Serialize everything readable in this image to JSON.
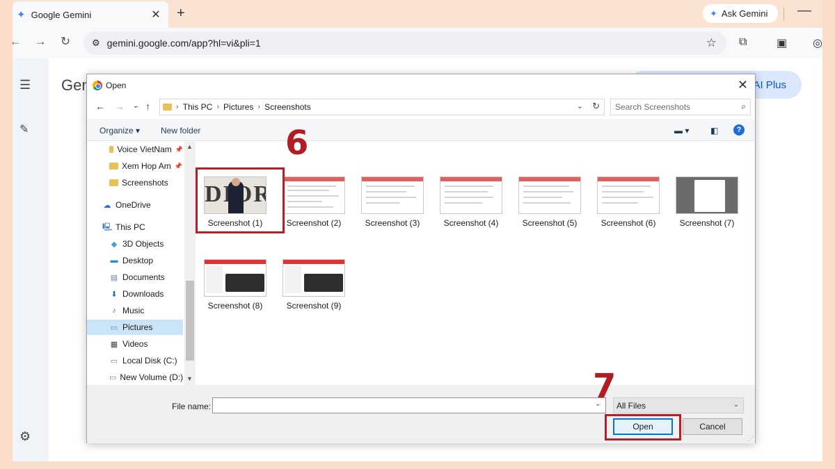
{
  "browser": {
    "tab_title": "Google Gemini",
    "tab_close": "✕",
    "new_tab": "+",
    "ask_gemini": "Ask Gemini",
    "url": "gemini.google.com/app?hl=vi&pli=1"
  },
  "gemini": {
    "title_partial": "Gen",
    "plus_label": "AI Plus"
  },
  "dialog": {
    "title": "Open",
    "breadcrumb": [
      "This PC",
      "Pictures",
      "Screenshots"
    ],
    "search_placeholder": "Search Screenshots",
    "organize": "Organize ▾",
    "new_folder": "New folder",
    "help": "?",
    "nav_items": [
      {
        "label": "Voice VietNam",
        "pinned": true
      },
      {
        "label": "Xem Hop Am",
        "pinned": true
      },
      {
        "label": "Screenshots"
      },
      {
        "label": "OneDrive"
      },
      {
        "label": "This PC"
      },
      {
        "label": "3D Objects"
      },
      {
        "label": "Desktop"
      },
      {
        "label": "Documents"
      },
      {
        "label": "Downloads"
      },
      {
        "label": "Music"
      },
      {
        "label": "Pictures",
        "selected": true
      },
      {
        "label": "Videos"
      },
      {
        "label": "Local Disk (C:)"
      },
      {
        "label": "New Volume (D:)"
      }
    ],
    "files": [
      "Screenshot (1)",
      "Screenshot (2)",
      "Screenshot (3)",
      "Screenshot (4)",
      "Screenshot (5)",
      "Screenshot (6)",
      "Screenshot (7)",
      "Screenshot (8)",
      "Screenshot (9)"
    ],
    "thumb_text": "DIOR",
    "file_name_label": "File name:",
    "file_name_value": "",
    "filter": "All Files",
    "open_button": "Open",
    "cancel_button": "Cancel"
  },
  "annotations": {
    "step6": "6",
    "step7": "7",
    "highlight_color": "#b41f2a"
  }
}
